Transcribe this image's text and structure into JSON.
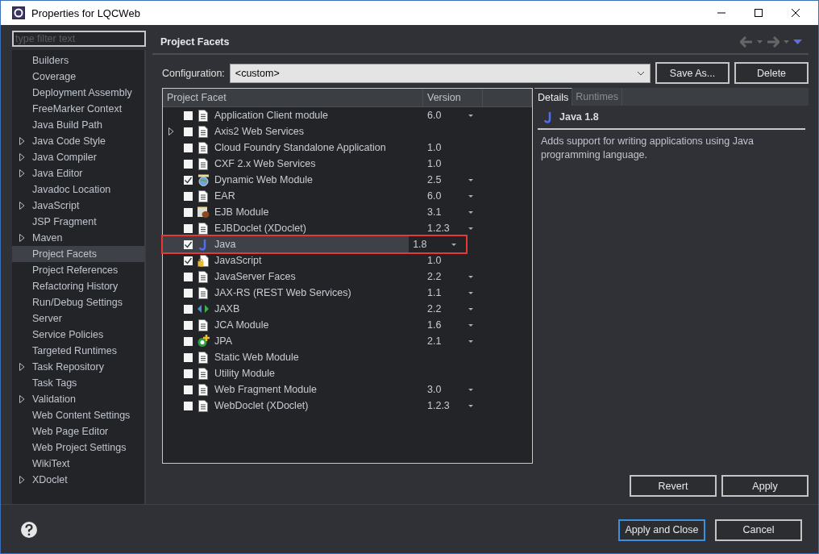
{
  "window": {
    "title": "Properties for LQCWeb"
  },
  "sidebar": {
    "filter_placeholder": "type filter text",
    "items": [
      {
        "label": "Builders",
        "expandable": false,
        "selected": false
      },
      {
        "label": "Coverage",
        "expandable": false,
        "selected": false
      },
      {
        "label": "Deployment Assembly",
        "expandable": false,
        "selected": false
      },
      {
        "label": "FreeMarker Context",
        "expandable": false,
        "selected": false
      },
      {
        "label": "Java Build Path",
        "expandable": false,
        "selected": false
      },
      {
        "label": "Java Code Style",
        "expandable": true,
        "selected": false
      },
      {
        "label": "Java Compiler",
        "expandable": true,
        "selected": false
      },
      {
        "label": "Java Editor",
        "expandable": true,
        "selected": false
      },
      {
        "label": "Javadoc Location",
        "expandable": false,
        "selected": false
      },
      {
        "label": "JavaScript",
        "expandable": true,
        "selected": false
      },
      {
        "label": "JSP Fragment",
        "expandable": false,
        "selected": false
      },
      {
        "label": "Maven",
        "expandable": true,
        "selected": false
      },
      {
        "label": "Project Facets",
        "expandable": false,
        "selected": true
      },
      {
        "label": "Project References",
        "expandable": false,
        "selected": false
      },
      {
        "label": "Refactoring History",
        "expandable": false,
        "selected": false
      },
      {
        "label": "Run/Debug Settings",
        "expandable": false,
        "selected": false
      },
      {
        "label": "Server",
        "expandable": false,
        "selected": false
      },
      {
        "label": "Service Policies",
        "expandable": false,
        "selected": false
      },
      {
        "label": "Targeted Runtimes",
        "expandable": false,
        "selected": false
      },
      {
        "label": "Task Repository",
        "expandable": true,
        "selected": false
      },
      {
        "label": "Task Tags",
        "expandable": false,
        "selected": false
      },
      {
        "label": "Validation",
        "expandable": true,
        "selected": false
      },
      {
        "label": "Web Content Settings",
        "expandable": false,
        "selected": false
      },
      {
        "label": "Web Page Editor",
        "expandable": false,
        "selected": false
      },
      {
        "label": "Web Project Settings",
        "expandable": false,
        "selected": false
      },
      {
        "label": "WikiText",
        "expandable": false,
        "selected": false
      },
      {
        "label": "XDoclet",
        "expandable": true,
        "selected": false
      }
    ]
  },
  "page": {
    "title": "Project Facets"
  },
  "configuration": {
    "label": "Configuration:",
    "value": "<custom>",
    "buttons": [
      "Save As...",
      "Delete"
    ]
  },
  "table": {
    "columns": [
      "Project Facet",
      "Version"
    ],
    "rows": [
      {
        "kind": "document",
        "name": "Application Client module",
        "version": "6.0",
        "dropdown": true,
        "checked": false,
        "expandable": false,
        "selected": false,
        "highlighted": false
      },
      {
        "kind": "document",
        "name": "Axis2 Web Services",
        "dropdown": false,
        "checked": false,
        "expandable": true,
        "selected": false,
        "highlighted": false
      },
      {
        "kind": "document",
        "name": "Cloud Foundry Standalone Application",
        "version": "1.0",
        "dropdown": false,
        "checked": false,
        "expandable": false,
        "selected": false,
        "highlighted": false
      },
      {
        "kind": "document",
        "name": "CXF 2.x Web Services",
        "version": "1.0",
        "dropdown": false,
        "checked": false,
        "expandable": false,
        "selected": false,
        "highlighted": false
      },
      {
        "kind": "globe",
        "name": "Dynamic Web Module",
        "version": "2.5",
        "dropdown": true,
        "checked": true,
        "expandable": false,
        "selected": false,
        "highlighted": false
      },
      {
        "kind": "document",
        "name": "EAR",
        "version": "6.0",
        "dropdown": true,
        "checked": false,
        "expandable": false,
        "selected": false,
        "highlighted": false
      },
      {
        "kind": "bean",
        "name": "EJB Module",
        "version": "3.1",
        "dropdown": true,
        "checked": false,
        "expandable": false,
        "selected": false,
        "highlighted": false
      },
      {
        "kind": "document",
        "name": "EJBDoclet (XDoclet)",
        "version": "1.2.3",
        "dropdown": true,
        "checked": false,
        "expandable": false,
        "selected": false,
        "highlighted": false
      },
      {
        "kind": "java",
        "name": "Java",
        "version": "1.8",
        "dropdown": true,
        "checked": true,
        "expandable": false,
        "selected": true,
        "highlighted": true
      },
      {
        "kind": "locked",
        "name": "JavaScript",
        "version": "1.0",
        "dropdown": false,
        "checked": true,
        "expandable": false,
        "selected": false,
        "highlighted": false
      },
      {
        "kind": "document",
        "name": "JavaServer Faces",
        "version": "2.2",
        "dropdown": true,
        "checked": false,
        "expandable": false,
        "selected": false,
        "highlighted": false
      },
      {
        "kind": "document",
        "name": "JAX-RS (REST Web Services)",
        "version": "1.1",
        "dropdown": true,
        "checked": false,
        "expandable": false,
        "selected": false,
        "highlighted": false
      },
      {
        "kind": "arrows",
        "name": "JAXB",
        "version": "2.2",
        "dropdown": true,
        "checked": false,
        "expandable": false,
        "selected": false,
        "highlighted": false
      },
      {
        "kind": "document",
        "name": "JCA Module",
        "version": "1.6",
        "dropdown": true,
        "checked": false,
        "expandable": false,
        "selected": false,
        "highlighted": false
      },
      {
        "kind": "jpa",
        "name": "JPA",
        "version": "2.1",
        "dropdown": true,
        "checked": false,
        "expandable": false,
        "selected": false,
        "highlighted": false
      },
      {
        "kind": "document",
        "name": "Static Web Module",
        "dropdown": false,
        "checked": false,
        "expandable": false,
        "selected": false,
        "highlighted": false
      },
      {
        "kind": "document",
        "name": "Utility Module",
        "dropdown": false,
        "checked": false,
        "expandable": false,
        "selected": false,
        "highlighted": false
      },
      {
        "kind": "document",
        "name": "Web Fragment Module",
        "version": "3.0",
        "dropdown": true,
        "checked": false,
        "expandable": false,
        "selected": false,
        "highlighted": false
      },
      {
        "kind": "document",
        "name": "WebDoclet (XDoclet)",
        "version": "1.2.3",
        "dropdown": true,
        "checked": false,
        "expandable": false,
        "selected": false,
        "highlighted": false
      }
    ]
  },
  "details": {
    "tabs": [
      {
        "label": "Details",
        "selected": true
      },
      {
        "label": "Runtimes",
        "selected": false
      }
    ],
    "title": "Java 1.8",
    "description": "Adds support for writing applications using Java programming language."
  },
  "page_buttons": [
    "Revert",
    "Apply"
  ],
  "dialog_buttons": [
    {
      "label": "Apply and Close",
      "default": true
    },
    {
      "label": "Cancel",
      "default": false
    }
  ]
}
